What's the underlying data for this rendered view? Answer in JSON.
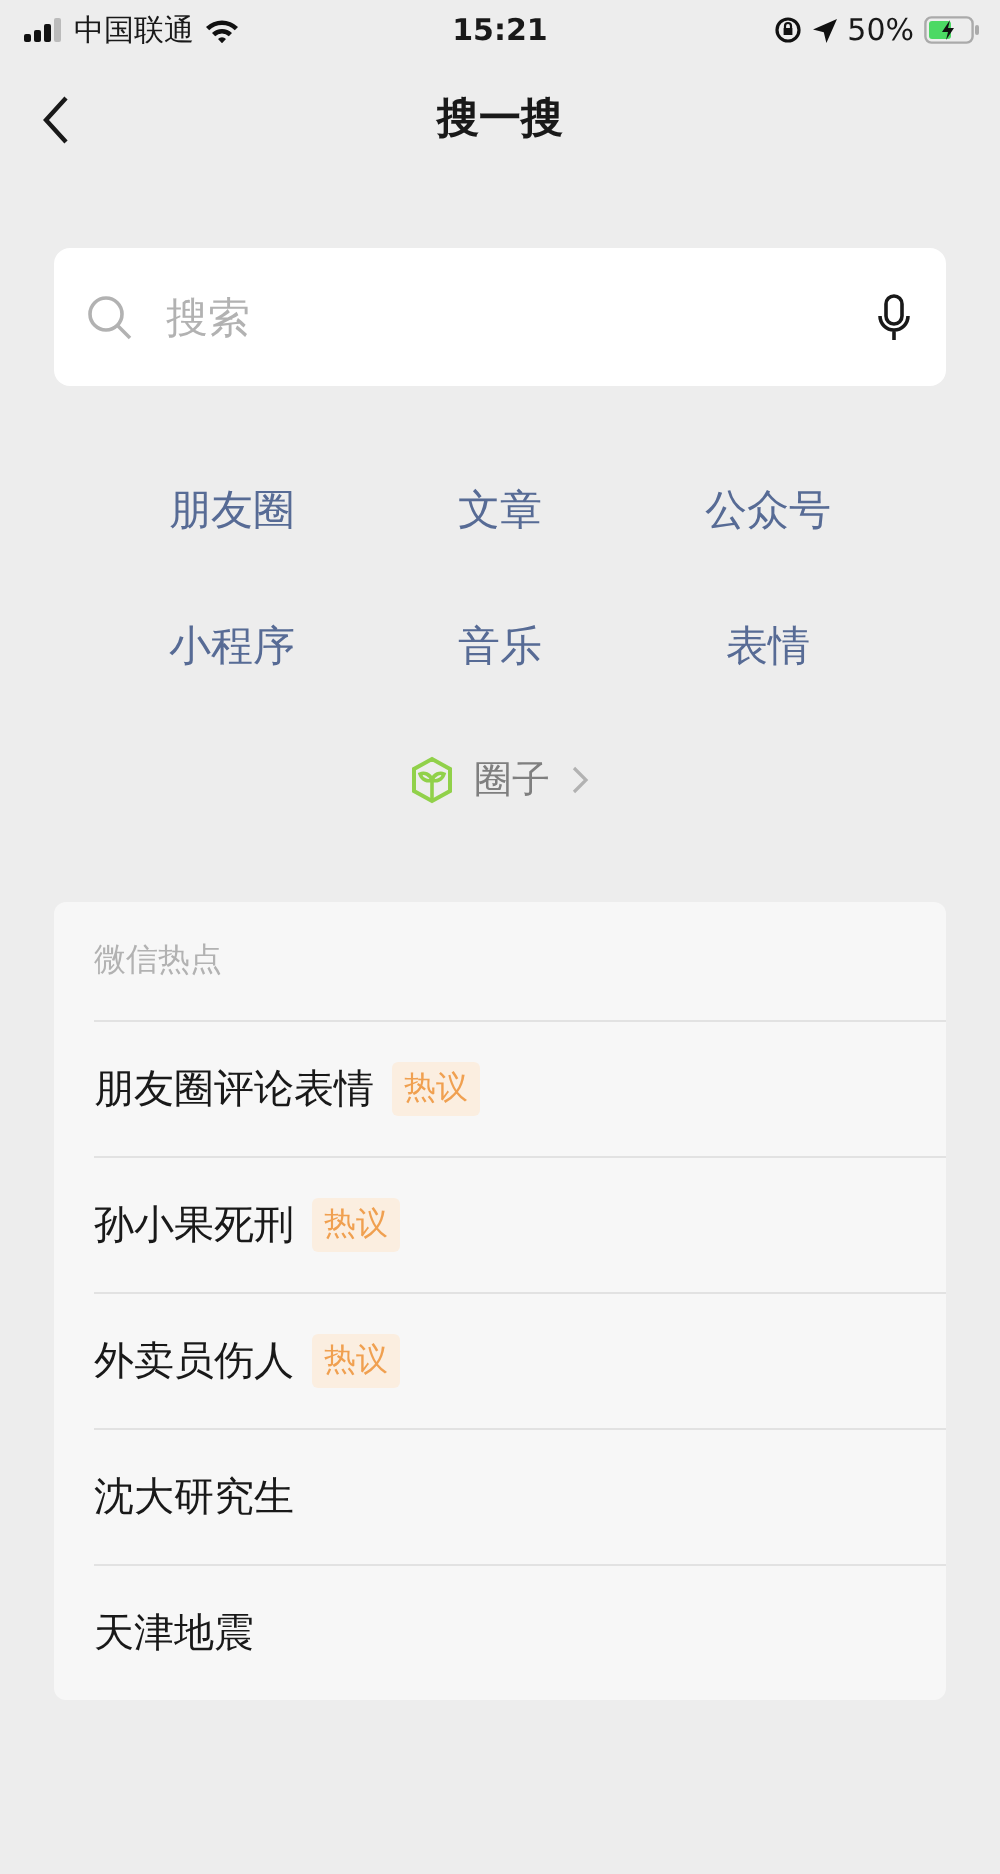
{
  "status_bar": {
    "carrier": "中国联通",
    "time": "15:21",
    "battery": "50%"
  },
  "nav": {
    "title": "搜一搜"
  },
  "search": {
    "placeholder": "搜索"
  },
  "categories": [
    "朋友圈",
    "文章",
    "公众号",
    "小程序",
    "音乐",
    "表情"
  ],
  "circle_link": {
    "label": "圈子"
  },
  "hot": {
    "title": "微信热点",
    "items": [
      {
        "text": "朋友圈评论表情",
        "tag": "热议"
      },
      {
        "text": "孙小果死刑",
        "tag": "热议"
      },
      {
        "text": "外卖员伤人",
        "tag": "热议"
      },
      {
        "text": "沈大研究生"
      },
      {
        "text": "天津地震"
      }
    ]
  }
}
